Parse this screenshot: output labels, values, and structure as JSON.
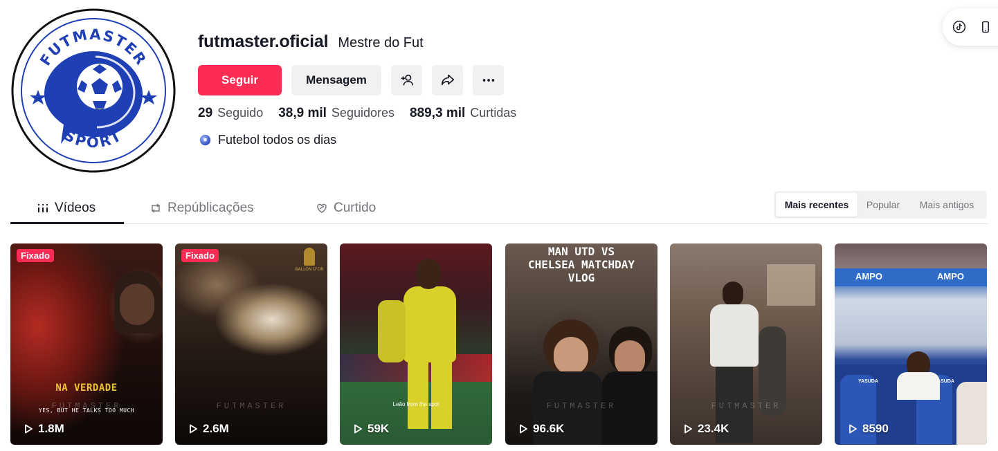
{
  "profile": {
    "username": "futmaster.oficial",
    "nickname": "Mestre do Fut",
    "logo_text_top": "FUTMASTER",
    "logo_text_bottom": "SPORT",
    "bio": "Futebol todos os dias",
    "bio_icon": "globe-ball-icon"
  },
  "actions": {
    "follow_label": "Seguir",
    "message_label": "Mensagem",
    "add_friend_icon": "add-friend-icon",
    "share_icon": "share-icon",
    "more_icon": "more-icon"
  },
  "stats": {
    "following_count": "29",
    "following_label": "Seguido",
    "followers_count": "38,9 mil",
    "followers_label": "Seguidores",
    "likes_count": "889,3 mil",
    "likes_label": "Curtidas"
  },
  "tabs": [
    {
      "label": "Vídeos",
      "icon": "grid-icon",
      "active": true
    },
    {
      "label": "Repúblicações",
      "icon": "repost-icon",
      "active": false
    },
    {
      "label": "Curtido",
      "icon": "liked-heart-icon",
      "active": false
    }
  ],
  "sort": {
    "options": [
      "Mais recentes",
      "Popular",
      "Mais antigos"
    ],
    "selected": "Mais recentes"
  },
  "videos": [
    {
      "pinned_label": "Fixado",
      "views": "1.8M",
      "caption_main": "NA VERDADE",
      "caption_sub": "YES, BUT HE TALKS TOO MUCH",
      "watermark": "FUTMASTER"
    },
    {
      "pinned_label": "Fixado",
      "views": "2.6M",
      "watermark": "FUTMASTER",
      "badge": "BALLON D'OR"
    },
    {
      "views": "59K",
      "caption_sub": "Leão from the spot"
    },
    {
      "views": "96.6K",
      "caption_main": "MAN UTD VS CHELSEA MATCHDAY VLOG",
      "watermark": "FUTMASTER"
    },
    {
      "views": "23.4K",
      "watermark": "FUTMASTER"
    },
    {
      "views": "8590",
      "sign_text": "AMPO",
      "seat_text": "YASUDA"
    }
  ],
  "colors": {
    "accent": "#fe2c55",
    "text": "#161823",
    "secondary_text": "#75767c",
    "button_bg": "#f1f1f2",
    "logo_blue": "#1f3fb4"
  }
}
